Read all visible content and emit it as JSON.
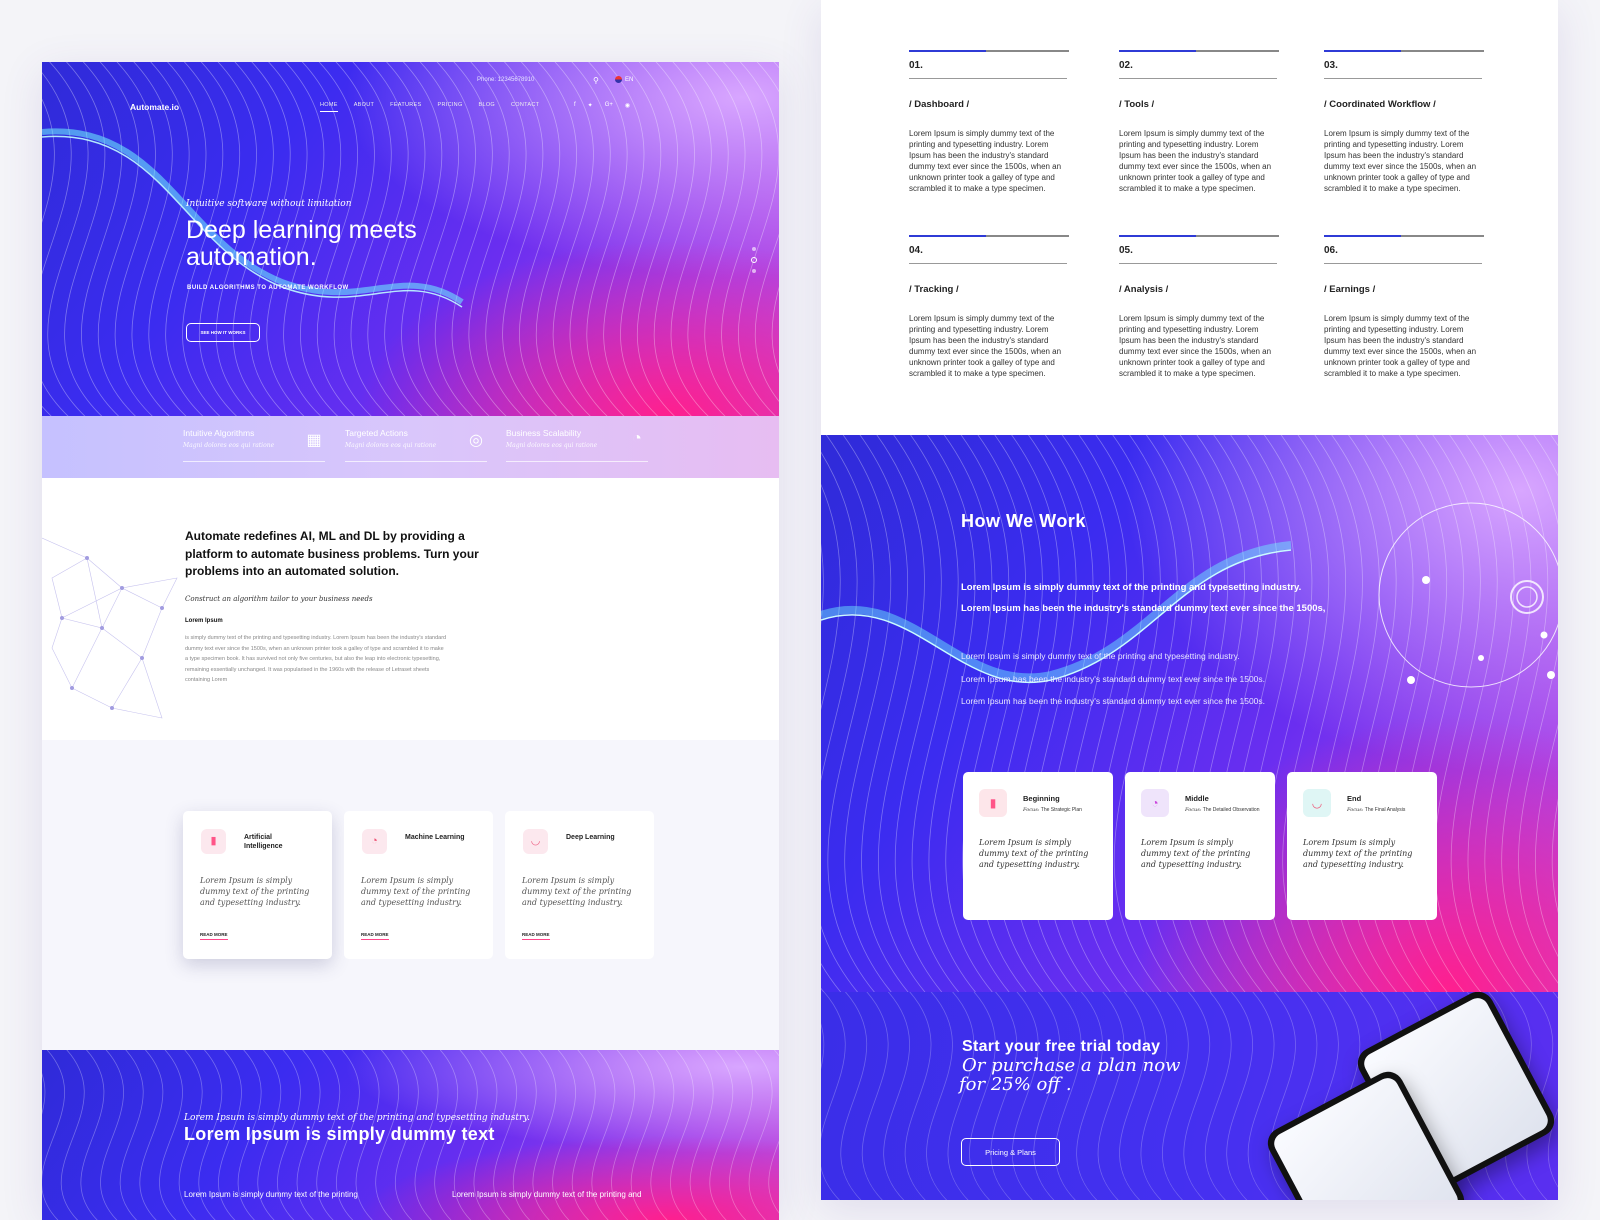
{
  "hero": {
    "phone": "Phone: 12345678910",
    "lang": "EN",
    "logo": "Automate.io",
    "nav": [
      "HOME",
      "ABOUT",
      "FEATURES",
      "PRICING",
      "BLOG",
      "CONTACT"
    ],
    "kicker": "Intuitive software without limitation",
    "title": "Deep learning meets automation.",
    "subtitle": "BUILD ALGORITHMS TO AUTOMATE WORKFLOW",
    "cta": "SEE HOW IT WORKS"
  },
  "strip": [
    {
      "title": "Intuitive Algorithms",
      "desc": "Magni dolores eos qui ratione",
      "icon": "puzzle-icon"
    },
    {
      "title": "Targeted Actions",
      "desc": "Magni dolores eos qui ratione",
      "icon": "target-icon"
    },
    {
      "title": "Business Scalability",
      "desc": "Magni dolores eos qui ratione",
      "icon": "pie-chart-icon"
    }
  ],
  "about": {
    "title": "Automate redefines AI, ML and DL by providing a platform to automate business problems. Turn your problems into an automated solution.",
    "kicker": "Construct an algorithm tailor to your business needs",
    "label": "Lorem Ipsum",
    "body": "is simply dummy text of the printing and typesetting industry. Lorem Ipsum has been the industry's standard dummy text ever since the 1500s, when an unknown printer took a galley of type and scrambled it to make a type specimen book. It has survived not only five centuries, but also the leap into electronic typesetting, remaining essentially unchanged. It was popularised in the 1960s with the release of Letraset sheets containing Lorem"
  },
  "cards": [
    {
      "title": "Artificial Intelligence",
      "text": "Lorem Ipsum is simply dummy text of the printing and typesetting industry.",
      "more": "READ MORE",
      "icon": "bar-chart-icon"
    },
    {
      "title": "Machine Learning",
      "text": "Lorem Ipsum is simply dummy text of the printing and typesetting industry.",
      "more": "READ MORE",
      "icon": "pie-chart-icon"
    },
    {
      "title": "Deep Learning",
      "text": "Lorem Ipsum is simply dummy text of the printing and typesetting industry.",
      "more": "READ MORE",
      "icon": "gauge-icon"
    }
  ],
  "bottom_hero": {
    "kicker": "Lorem Ipsum is simply dummy text of the printing and typesetting industry.",
    "title": "Lorem Ipsum is simply dummy text",
    "col1": "Lorem Ipsum is simply dummy text of the printing",
    "col2": "Lorem Ipsum is simply dummy text of the printing and"
  },
  "steps": [
    {
      "num": "01.",
      "title": "/  Dashboard  /",
      "body": "Lorem Ipsum is simply dummy text of the printing and typesetting industry. Lorem Ipsum has been the industry's standard dummy text ever since the 1500s, when an unknown printer took a galley of type and scrambled it to make a type specimen."
    },
    {
      "num": "02.",
      "title": "/  Tools  /",
      "body": "Lorem Ipsum is simply dummy text of the printing and typesetting industry. Lorem Ipsum has been the industry's standard dummy text ever since the 1500s, when an unknown printer took a galley of type and scrambled it to make a type specimen."
    },
    {
      "num": "03.",
      "title": "/  Coordinated Workflow  /",
      "body": "Lorem Ipsum is simply dummy text of the printing and typesetting industry. Lorem Ipsum has been the industry's standard dummy text ever since the 1500s, when an unknown printer took a galley of type and scrambled it to make a type specimen."
    },
    {
      "num": "04.",
      "title": "/  Tracking  /",
      "body": "Lorem Ipsum is simply dummy text of the printing and typesetting industry. Lorem Ipsum has been the industry's standard dummy text ever since the 1500s, when an unknown printer took a galley of type and scrambled it to make a type specimen."
    },
    {
      "num": "05.",
      "title": "/  Analysis  /",
      "body": "Lorem Ipsum is simply dummy text of the printing and typesetting industry. Lorem Ipsum has been the industry's standard dummy text ever since the 1500s, when an unknown printer took a galley of type and scrambled it to make a type specimen."
    },
    {
      "num": "06.",
      "title": "/  Earnings  /",
      "body": "Lorem Ipsum is simply dummy text of the printing and typesetting industry. Lorem Ipsum has been the industry's standard dummy text ever since the 1500s, when an unknown printer took a galley of type and scrambled it to make a type specimen."
    }
  ],
  "how": {
    "title": "How We Work",
    "lead1": "Lorem Ipsum is simply dummy text of the printing and typesetting industry.",
    "lead2": "Lorem Ipsum has been the industry's standard dummy text ever since the 1500s,",
    "body1": "Lorem Ipsum is simply dummy text of the printing and typesetting industry.",
    "body2": "Lorem Ipsum has been the industry's standard dummy text ever since the 1500s.",
    "body3": "Lorem Ipsum has been the industry's standard dummy text ever since the 1500s.",
    "cards": [
      {
        "title": "Beginning",
        "focus_label": "Focus:",
        "focus": "The Strategic Plan",
        "text": "Lorem Ipsum is simply dummy text of the printing and typesetting industry.",
        "icon": "bar-chart-icon",
        "color": "#fde6ea"
      },
      {
        "title": "Middle",
        "focus_label": "Focus:",
        "focus": "The Detailed Observation",
        "text": "Lorem Ipsum is simply dummy text of the printing and typesetting industry.",
        "icon": "pie-chart-icon",
        "color": "#efe4fb"
      },
      {
        "title": "End",
        "focus_label": "Focus:",
        "focus": "The Final Analysis",
        "text": "Lorem Ipsum is simply dummy text of the printing and typesetting industry.",
        "icon": "gauge-icon",
        "color": "#dff6f5"
      }
    ]
  },
  "trial": {
    "title": "Start your free trial today",
    "sub1": "Or purchase a plan now",
    "sub2": "for 25% off .",
    "cta": "Pricing & Plans"
  }
}
